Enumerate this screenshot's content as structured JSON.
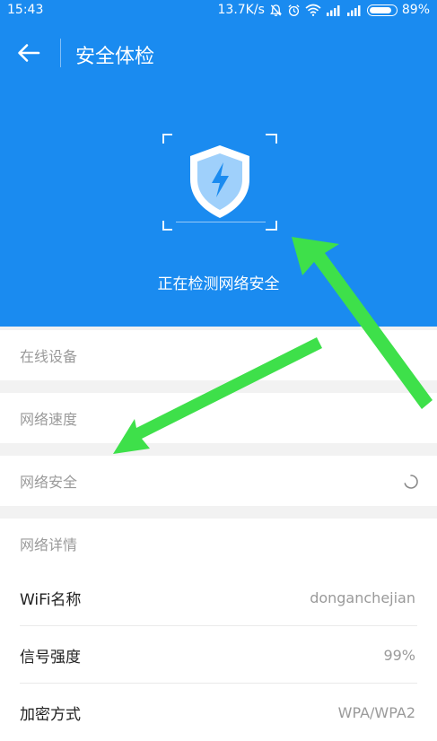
{
  "status_bar": {
    "time": "15:43",
    "net_speed": "13.7K/s",
    "battery_level": 0.89,
    "battery_text": "89%"
  },
  "nav": {
    "back_icon": "arrow-left-icon",
    "title": "安全体检"
  },
  "scan": {
    "icon": "shield-lightning-icon",
    "status_text": "正在检测网络安全"
  },
  "check_items": [
    {
      "label": "在线设备"
    },
    {
      "label": "网络速度"
    },
    {
      "label": "网络安全",
      "state": "loading"
    }
  ],
  "details": {
    "section_title": "网络详情",
    "rows": [
      {
        "label": "WiFi名称",
        "value": "donganchejian"
      },
      {
        "label": "信号强度",
        "value": "99%"
      },
      {
        "label": "加密方式",
        "value": "WPA/WPA2"
      }
    ]
  },
  "colors": {
    "primary": "#1a8bf0",
    "annotation_arrow": "#3ee04a"
  }
}
